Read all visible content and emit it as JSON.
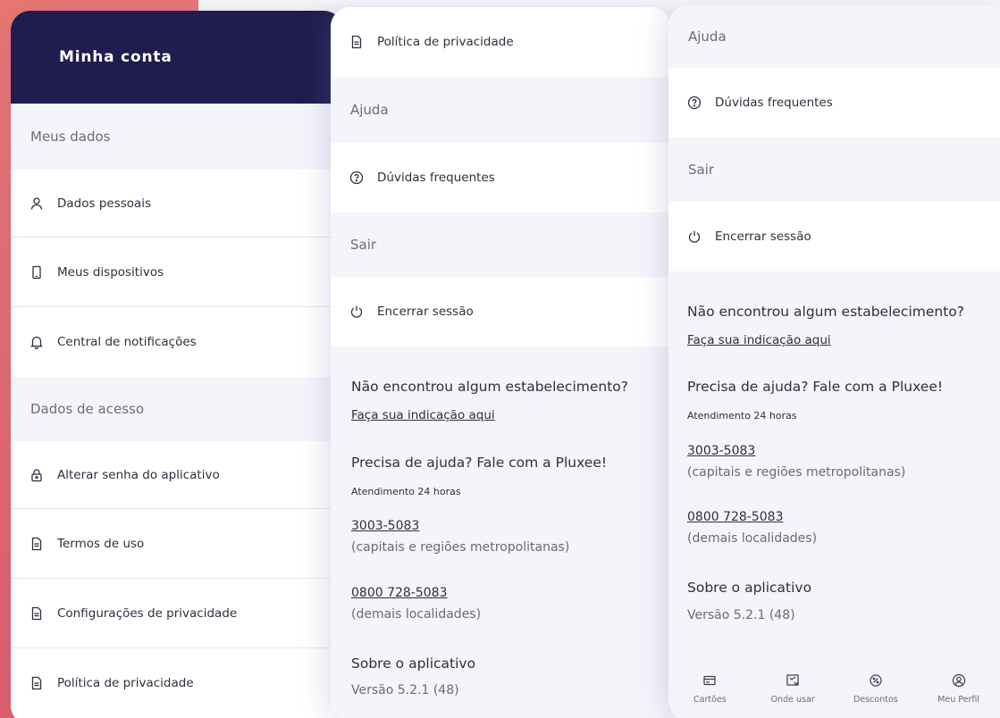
{
  "screen1": {
    "header_title": "Minha conta",
    "section_personal": "Meus dados",
    "personal_items": {
      "dados_pessoais": "Dados pessoais",
      "meus_dispositivos": "Meus dispositivos",
      "central_notificacoes": "Central de notificações"
    },
    "section_access": "Dados de acesso",
    "access_items": {
      "alterar_senha": "Alterar senha do aplicativo",
      "termos_uso": "Termos de uso",
      "config_privacidade": "Configurações de privacidade",
      "politica_privacidade": "Política de privacidade"
    }
  },
  "screen2": {
    "politica_privacidade": "Política de privacidade",
    "section_help": "Ajuda",
    "duvidas": "Dúvidas frequentes",
    "section_exit": "Sair",
    "encerrar": "Encerrar sessão",
    "nao_encontrou": "Não encontrou algum estabelecimento?",
    "indicacao_link": "Faça sua indicação aqui",
    "precisa_ajuda": "Precisa de ajuda? Fale com a Pluxee!",
    "atendimento": "Atendimento 24 horas",
    "phone1": "3003-5083",
    "phone1_desc": "(capitais e regiões metropolitanas)",
    "phone2": "0800 728-5083",
    "phone2_desc": "(demais localidades)",
    "sobre": "Sobre o aplicativo",
    "versao": "Versão 5.2.1 (48)"
  },
  "screen3": {
    "section_help": "Ajuda",
    "duvidas": "Dúvidas frequentes",
    "section_exit": "Sair",
    "encerrar": "Encerrar sessão",
    "nao_encontrou": "Não encontrou algum estabelecimento?",
    "indicacao_link": "Faça sua indicação aqui",
    "precisa_ajuda": "Precisa de ajuda? Fale com a Pluxee!",
    "atendimento": "Atendimento 24 horas",
    "phone1": "3003-5083",
    "phone1_desc": "(capitais e regiões metropolitanas)",
    "phone2": "0800 728-5083",
    "phone2_desc": "(demais localidades)",
    "sobre": "Sobre o aplicativo",
    "versao": "Versão 5.2.1 (48)",
    "tabs": {
      "cartoes": "Cartões",
      "onde_usar": "Onde usar",
      "descontos": "Descontos",
      "meu_perfil": "Meu Perfil"
    }
  },
  "colors": {
    "header_bg": "#211c4e",
    "accent_bg": "#f0766f",
    "section_bg": "#f4f4fb",
    "text": "#2f2f3f"
  },
  "icons": {
    "dados_pessoais": "person-icon",
    "meus_dispositivos": "phone-icon",
    "central_notificacoes": "bell-icon",
    "alterar_senha": "lock-icon",
    "documents": "document-icon",
    "duvidas": "help-circle-icon",
    "encerrar": "power-icon",
    "cartoes": "card-icon",
    "onde_usar": "map-icon",
    "descontos": "discount-icon",
    "meu_perfil": "profile-icon"
  }
}
